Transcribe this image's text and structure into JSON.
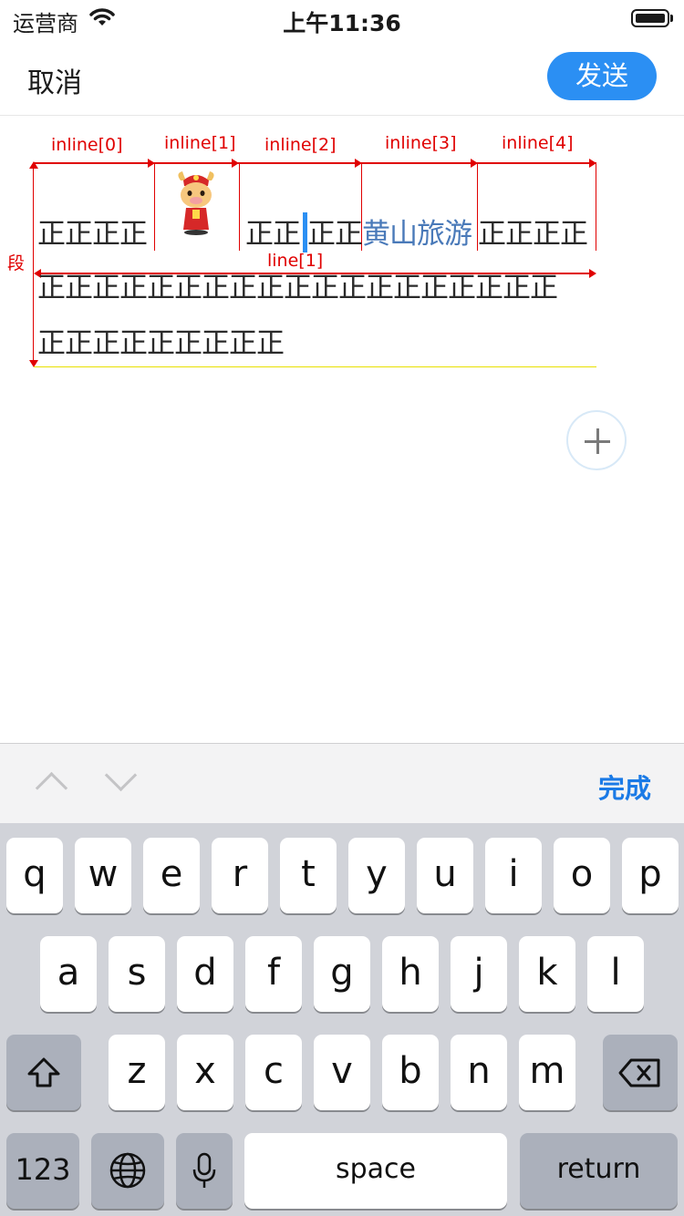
{
  "status_bar": {
    "carrier": "运营商",
    "time": "上午11:36"
  },
  "nav": {
    "cancel": "取消",
    "send": "发送"
  },
  "annotations": {
    "inline_labels": [
      "inline[0]",
      "inline[1]",
      "inline[2]",
      "inline[3]",
      "inline[4]"
    ],
    "line_label": "line[1]",
    "paragraph_label": "段"
  },
  "content": {
    "line0": {
      "seg0": "正正正正",
      "emoji_name": "cartoon-ox-sticker",
      "seg2a": "正正",
      "seg2b": "正正",
      "link": "黄山旅游",
      "seg4": "正正正正"
    },
    "line1": "正正正正正正正正正正正正正正正正正正正",
    "line2": "正正正正正正正正正"
  },
  "toolbar": {
    "done": "完成"
  },
  "keyboard": {
    "row1": [
      "q",
      "w",
      "e",
      "r",
      "t",
      "y",
      "u",
      "i",
      "o",
      "p"
    ],
    "row2": [
      "a",
      "s",
      "d",
      "f",
      "g",
      "h",
      "j",
      "k",
      "l"
    ],
    "row3": [
      "z",
      "x",
      "c",
      "v",
      "b",
      "n",
      "m"
    ],
    "numbers": "123",
    "space": "space",
    "return": "return"
  },
  "colors": {
    "accent": "#2b8ff3",
    "annotation": "#e00000",
    "link": "#4a7ab9"
  }
}
